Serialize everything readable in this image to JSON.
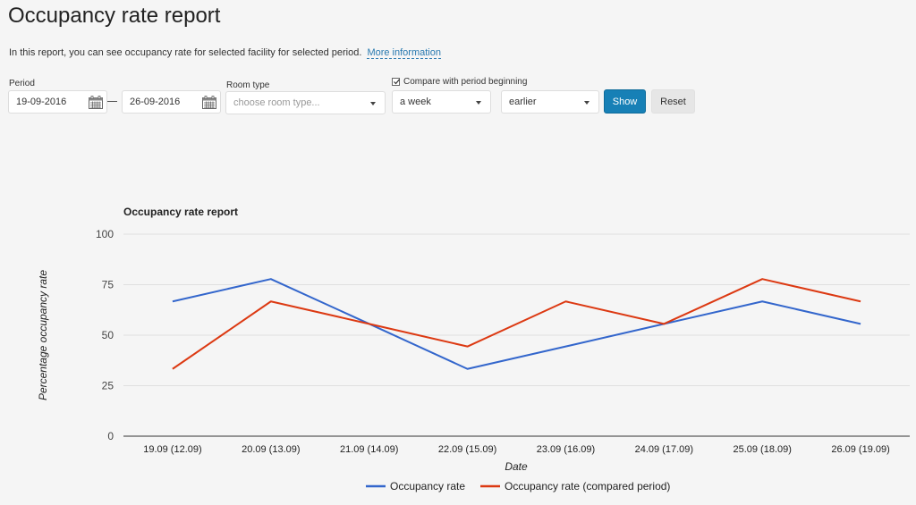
{
  "page": {
    "title": "Occupancy rate report",
    "intro_text": "In this report, you can see occupancy rate for selected facility for selected period.",
    "more_info_link": "More information"
  },
  "filters": {
    "period_label": "Period",
    "period_start": "19-09-2016",
    "period_end": "26-09-2016",
    "calendar_icon": "calendar-icon",
    "room_type_label": "Room type",
    "room_type_placeholder": "choose room type...",
    "compare_checked": true,
    "compare_label": "Compare with period beginning",
    "compare_offset": "a week",
    "compare_direction": "earlier",
    "show_label": "Show",
    "reset_label": "Reset"
  },
  "colors": {
    "primary_button": "#1780b6",
    "series_current": "#3366cc",
    "series_compared": "#dc3912"
  },
  "chart_data": {
    "type": "line",
    "title": "Occupancy rate report",
    "xlabel": "Date",
    "ylabel": "Percentage occupancy rate",
    "ylim": [
      0,
      100
    ],
    "yticks": [
      0,
      25,
      50,
      75,
      100
    ],
    "grid": true,
    "legend": "bottom",
    "categories": [
      "19.09 (12.09)",
      "20.09 (13.09)",
      "21.09 (14.09)",
      "22.09 (15.09)",
      "23.09 (16.09)",
      "24.09 (17.09)",
      "25.09 (18.09)",
      "26.09 (19.09)"
    ],
    "series": [
      {
        "name": "Occupancy rate",
        "color": "#3366cc",
        "values": [
          66.7,
          77.8,
          55.6,
          33.3,
          44.4,
          55.6,
          66.7,
          55.6
        ]
      },
      {
        "name": "Occupancy rate (compared period)",
        "color": "#dc3912",
        "values": [
          33.3,
          66.7,
          55.6,
          44.4,
          66.7,
          55.6,
          77.8,
          66.7
        ]
      }
    ]
  }
}
